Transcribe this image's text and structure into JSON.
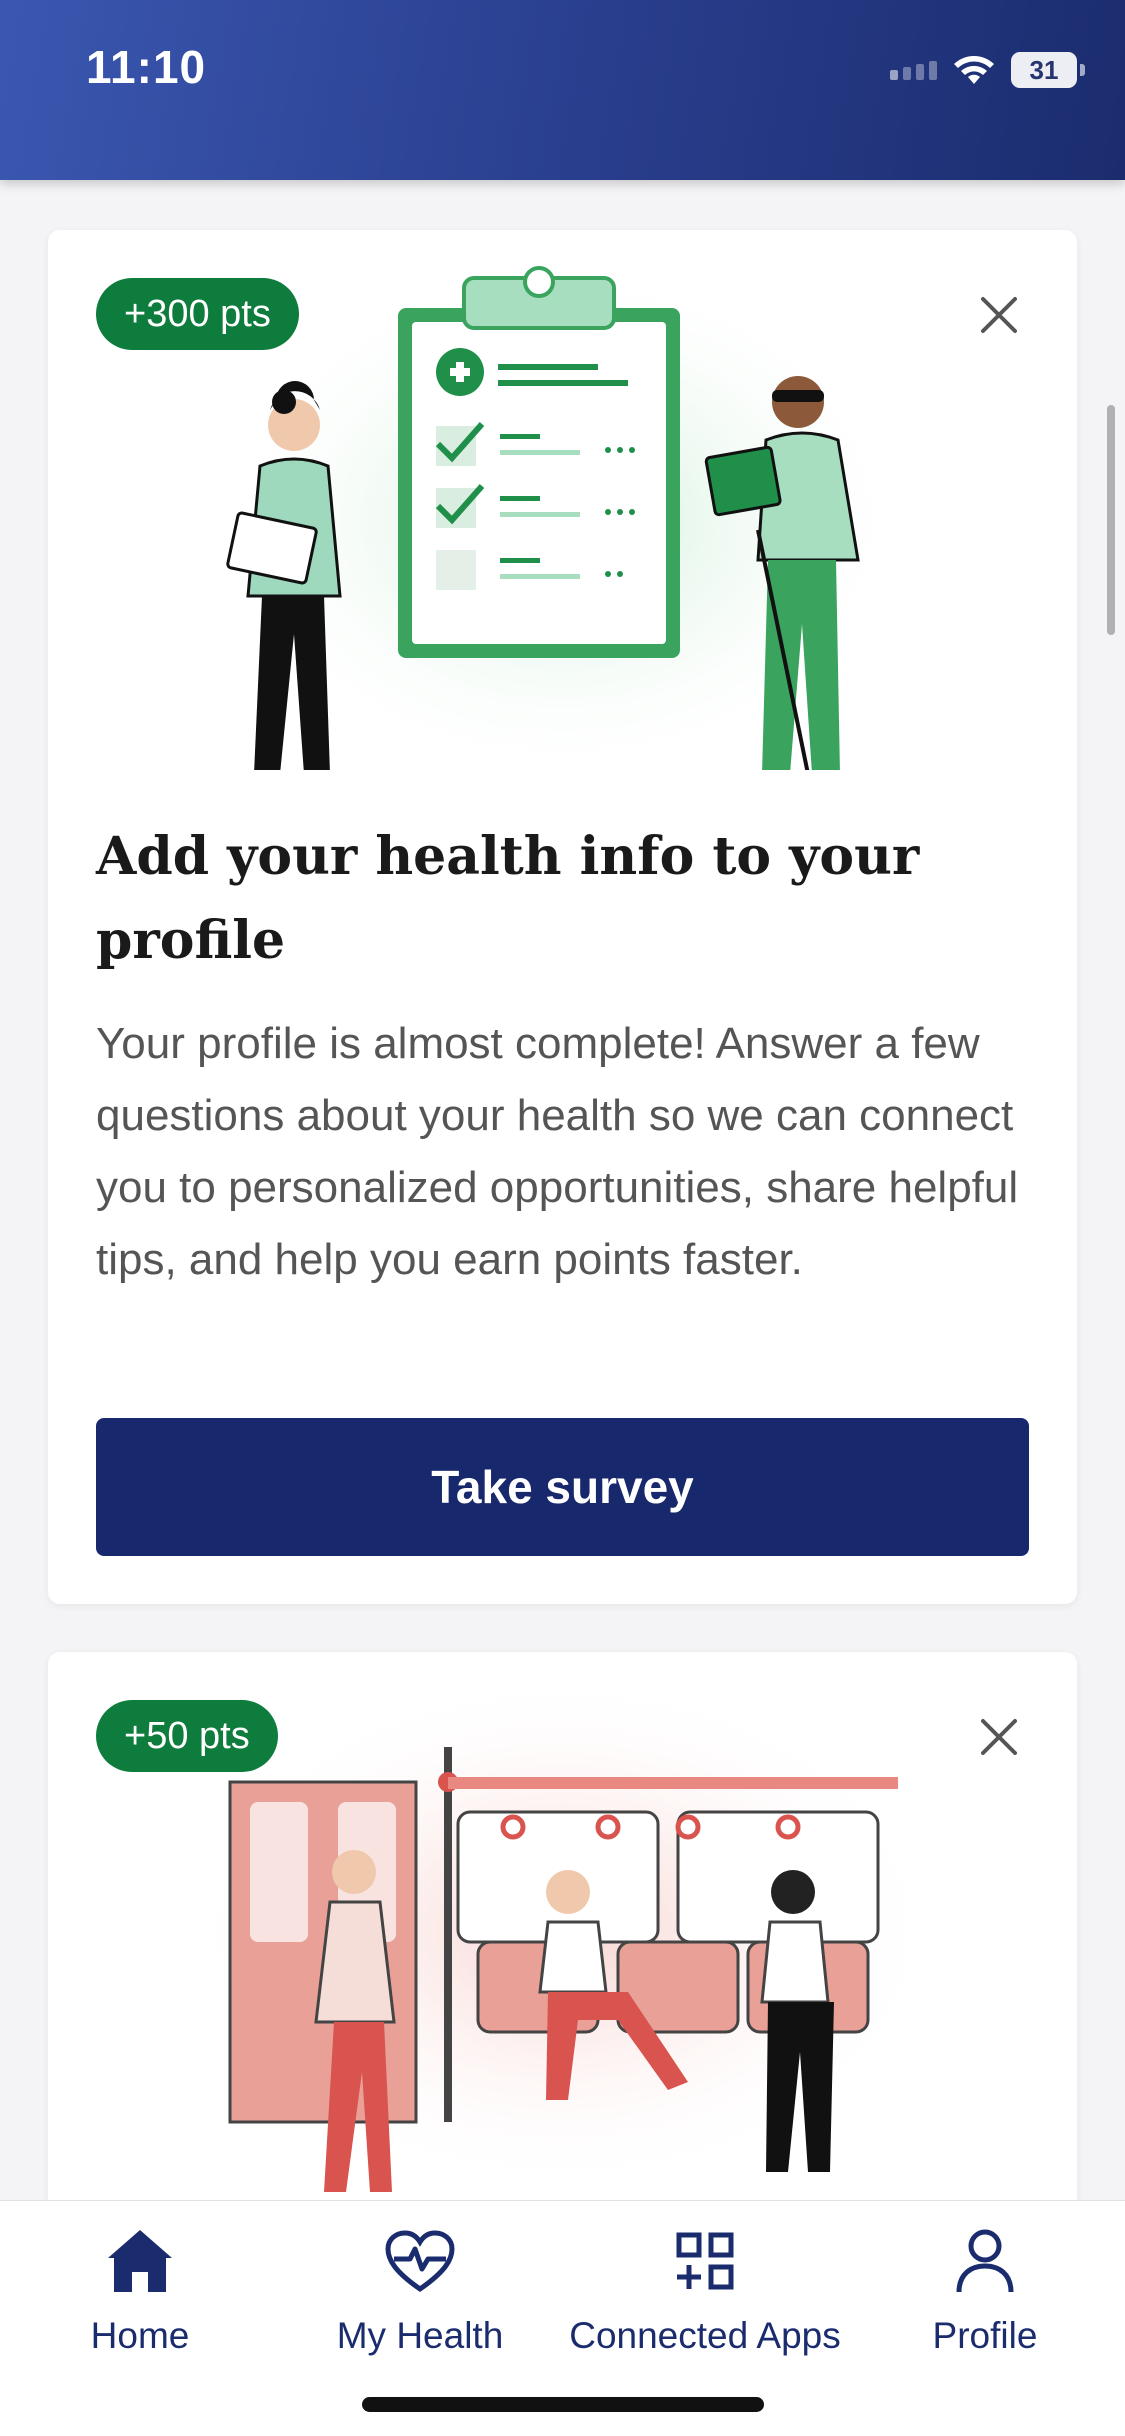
{
  "status_bar": {
    "time": "11:10",
    "battery": "31"
  },
  "cards": [
    {
      "points": "+300 pts",
      "title": "Add your health info to your profile",
      "body": "Your profile is almost complete! Answer a few questions about your health so we can connect you to personalized opportunities, share helpful tips, and help you earn points faster.",
      "button": "Take survey",
      "illustration": "health-survey-clipboard-illustration"
    },
    {
      "points": "+50 pts",
      "illustration": "subway-commuters-illustration"
    }
  ],
  "tabs": [
    {
      "label": "Home",
      "icon": "home-icon",
      "active": true
    },
    {
      "label": "My Health",
      "icon": "heart-pulse-icon",
      "active": false
    },
    {
      "label": "Connected Apps",
      "icon": "apps-grid-icon",
      "active": false
    },
    {
      "label": "Profile",
      "icon": "person-icon",
      "active": false
    }
  ],
  "colors": {
    "header": "#2a3f8f",
    "badge": "#0e7c3c",
    "primary_button": "#18286c",
    "tab_text": "#1b2c6e"
  }
}
